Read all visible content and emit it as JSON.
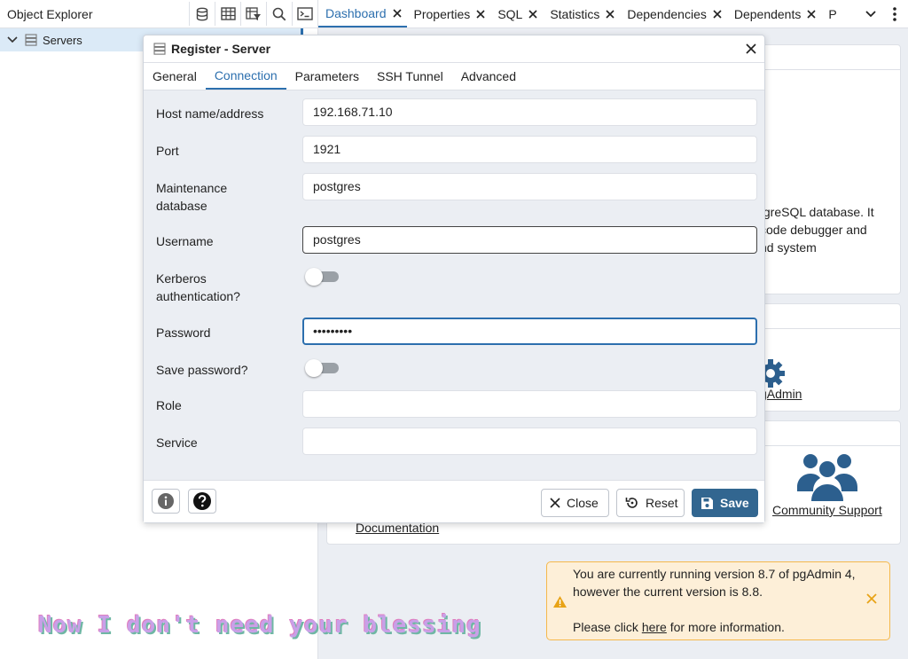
{
  "object_explorer": {
    "title": "Object Explorer",
    "tree": {
      "servers_label": "Servers"
    }
  },
  "tabs": [
    {
      "label": "Dashboard",
      "active": true
    },
    {
      "label": "Properties"
    },
    {
      "label": "SQL"
    },
    {
      "label": "Statistics"
    },
    {
      "label": "Dependencies"
    },
    {
      "label": "Dependents"
    },
    {
      "label": "P"
    }
  ],
  "dashboard": {
    "welcome_text": "tgreSQL database. It code debugger and nd system",
    "welcome_lines": [
      "tgreSQL database. It",
      "code debugger and",
      "nd system"
    ],
    "configure_link": "gAdmin",
    "community_support": "Community Support",
    "documentation": "Documentation"
  },
  "notification": {
    "line1": "You are currently running version 8.7 of pgAdmin 4,",
    "line2": "however the current version is 8.8.",
    "line3_prefix": "Please click ",
    "line3_link": "here",
    "line3_suffix": " for more information."
  },
  "caption": "Now I don't need your blessing",
  "dialog": {
    "title": "Register - Server",
    "tabs": [
      {
        "label": "General"
      },
      {
        "label": "Connection",
        "active": true
      },
      {
        "label": "Parameters"
      },
      {
        "label": "SSH Tunnel"
      },
      {
        "label": "Advanced"
      }
    ],
    "fields": {
      "host": {
        "label": "Host name/address",
        "value": "192.168.71.10"
      },
      "port": {
        "label": "Port",
        "value": "1921"
      },
      "maintenance_db": {
        "label_line1": "Maintenance",
        "label_line2": "database",
        "value": "postgres"
      },
      "username": {
        "label": "Username",
        "value": "postgres"
      },
      "kerberos": {
        "label_line1": "Kerberos",
        "label_line2": "authentication?",
        "enabled": false
      },
      "password": {
        "label": "Password",
        "value": "•••••••••"
      },
      "save_password": {
        "label": "Save password?",
        "enabled": false
      },
      "role": {
        "label": "Role",
        "value": ""
      },
      "service": {
        "label": "Service",
        "value": ""
      }
    },
    "buttons": {
      "close": "Close",
      "reset": "Reset",
      "save": "Save"
    }
  },
  "colors": {
    "accent": "#2c6fae",
    "save_button": "#326690",
    "warning_bg": "#fdefd8",
    "warning_border": "#f5b84c"
  }
}
